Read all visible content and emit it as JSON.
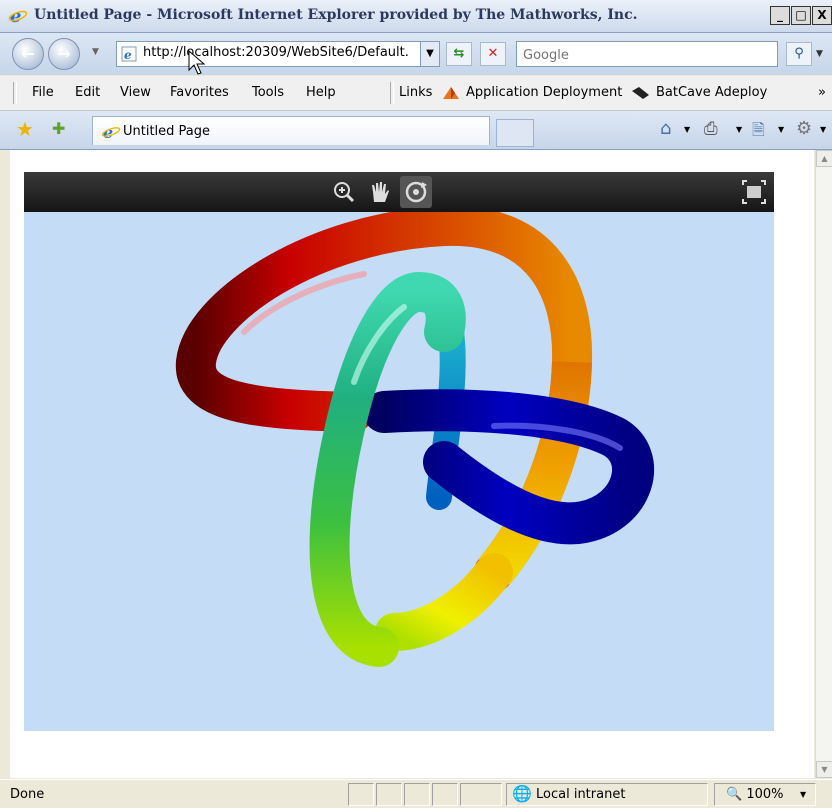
{
  "window": {
    "title": "Untitled Page - Microsoft Internet Explorer provided by The Mathworks, Inc.",
    "controls": {
      "minimize": "_",
      "maximize": "□",
      "close": "X"
    }
  },
  "address_bar": {
    "url": "http://localhost:20309/WebSite6/Default.",
    "search_placeholder": "Google"
  },
  "menu": {
    "items": [
      "File",
      "Edit",
      "View",
      "Favorites",
      "Tools",
      "Help"
    ]
  },
  "links_bar": {
    "label": "Links",
    "links": [
      "Application Deployment",
      "BatCave Adeploy"
    ],
    "chevron": "»"
  },
  "tabs": [
    {
      "label": "Untitled Page"
    }
  ],
  "figure_toolbar": {
    "tools": [
      "zoom-in-icon",
      "pan-hand-icon",
      "rotate-3d-icon"
    ],
    "active_tool": "rotate-3d-icon",
    "right_tool": "fit-to-window-icon"
  },
  "figure": {
    "background": "#c5dcf7",
    "description_colors": [
      "#c00000",
      "#e87a00",
      "#f2e200",
      "#3ccc8c",
      "#00008c"
    ]
  },
  "status_bar": {
    "text": "Done",
    "zone": "Local intranet",
    "zoom": "100%"
  }
}
